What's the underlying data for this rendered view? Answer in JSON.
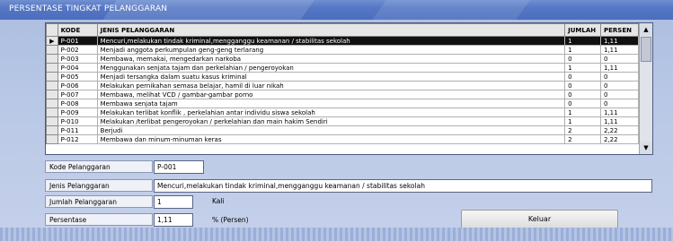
{
  "window": {
    "title": "PERSENTASE TINGKAT PELANGGARAN"
  },
  "grid": {
    "columns": [
      "KODE",
      "JENIS PELANGGARAN",
      "JUMLAH",
      "PERSEN"
    ],
    "rows": [
      {
        "kode": "P-001",
        "jenis": "Mencuri,melakukan tindak kriminal,mengganggu keamanan / stabilitas sekolah",
        "jumlah": "1",
        "persen": "1,11"
      },
      {
        "kode": "P-002",
        "jenis": "Menjadi anggota perkumpulan geng-geng terlarang",
        "jumlah": "1",
        "persen": "1,11"
      },
      {
        "kode": "P-003",
        "jenis": "Membawa, memakai, mengedarkan narkoba",
        "jumlah": "0",
        "persen": "0"
      },
      {
        "kode": "P-004",
        "jenis": "Menggunakan senjata tajam dan perkelahian / pengeroyokan",
        "jumlah": "1",
        "persen": "1,11"
      },
      {
        "kode": "P-005",
        "jenis": "Menjadi tersangka dalam suatu kasus kriminal",
        "jumlah": "0",
        "persen": "0"
      },
      {
        "kode": "P-006",
        "jenis": "Melakukan pernikahan semasa belajar, hamil di luar nikah",
        "jumlah": "0",
        "persen": "0"
      },
      {
        "kode": "P-007",
        "jenis": "Membawa, melihat VCD / gambar-gambar porno",
        "jumlah": "0",
        "persen": "0"
      },
      {
        "kode": "P-008",
        "jenis": "Membawa senjata tajam",
        "jumlah": "0",
        "persen": "0"
      },
      {
        "kode": "P-009",
        "jenis": "Melakukan terlibat konflik , perkelahian antar individu siswa sekolah",
        "jumlah": "1",
        "persen": "1,11"
      },
      {
        "kode": "P-010",
        "jenis": "Melakukan /terlibat pengeroyokan / perkelahian dan main hakim Sendiri",
        "jumlah": "1",
        "persen": "1,11"
      },
      {
        "kode": "P-011",
        "jenis": "Berjudi",
        "jumlah": "2",
        "persen": "2,22"
      },
      {
        "kode": "P-012",
        "jenis": "Membawa dan minum-minuman keras",
        "jumlah": "2",
        "persen": "2,22"
      }
    ],
    "selected_row": 0
  },
  "form": {
    "kode_label": "Kode Pelanggaran",
    "kode_value": "P-001",
    "jenis_label": "Jenis Pelanggaran",
    "jenis_value": "Mencuri,melakukan tindak kriminal,mengganggu keamanan / stabilitas sekolah",
    "jumlah_label": "Jumlah Pelanggaran",
    "jumlah_value": "1",
    "jumlah_unit": "Kali",
    "persen_label": "Persentase",
    "persen_value": "1,11",
    "persen_unit": "% (Persen)"
  },
  "buttons": {
    "keluar": "Keluar"
  }
}
